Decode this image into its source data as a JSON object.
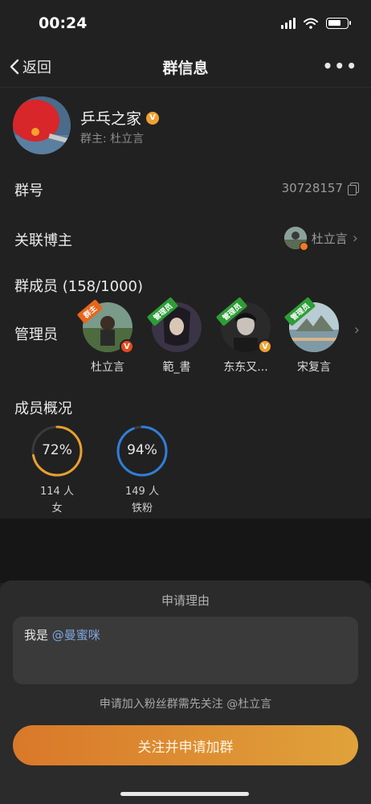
{
  "status_bar": {
    "time": "00:24"
  },
  "nav": {
    "back_label": "返回",
    "title": "群信息",
    "more_label": "•••"
  },
  "group": {
    "name": "乒乓之家",
    "owner_line": "群主: 杜立言",
    "verified_badge": "V"
  },
  "rows": {
    "group_id": {
      "label": "群号",
      "value": "30728157"
    },
    "linked_blogger": {
      "label": "关联博主",
      "value": "杜立言"
    },
    "members": {
      "label": "群成员 (158/1000)"
    },
    "admins": {
      "label": "管理员"
    },
    "overview": {
      "label": "成员概况"
    }
  },
  "admins": [
    {
      "name": "杜立言",
      "ribbon": "群主",
      "badge": "V"
    },
    {
      "name": "範_書",
      "ribbon": "管理员",
      "badge": ""
    },
    {
      "name": "东东又...",
      "ribbon": "管理员",
      "badge": "V"
    },
    {
      "name": "宋复言",
      "ribbon": "管理员",
      "badge": ""
    }
  ],
  "stats": [
    {
      "percent_text": "72%",
      "percent": 0.72,
      "count": "114 人",
      "label": "女",
      "color": "#e8a030"
    },
    {
      "percent_text": "94%",
      "percent": 0.94,
      "count": "149 人",
      "label": "铁粉",
      "color": "#2f7fd8"
    }
  ],
  "sheet": {
    "title": "申请理由",
    "reason_prefix": "我是 ",
    "reason_mention": "@曼蜜咪",
    "note": "申请加入粉丝群需先关注 @杜立言",
    "button": "关注并申请加群"
  },
  "colors": {
    "background": "#212121",
    "accent_orange": "#e0902e",
    "mention_blue": "#7fa6e0"
  }
}
